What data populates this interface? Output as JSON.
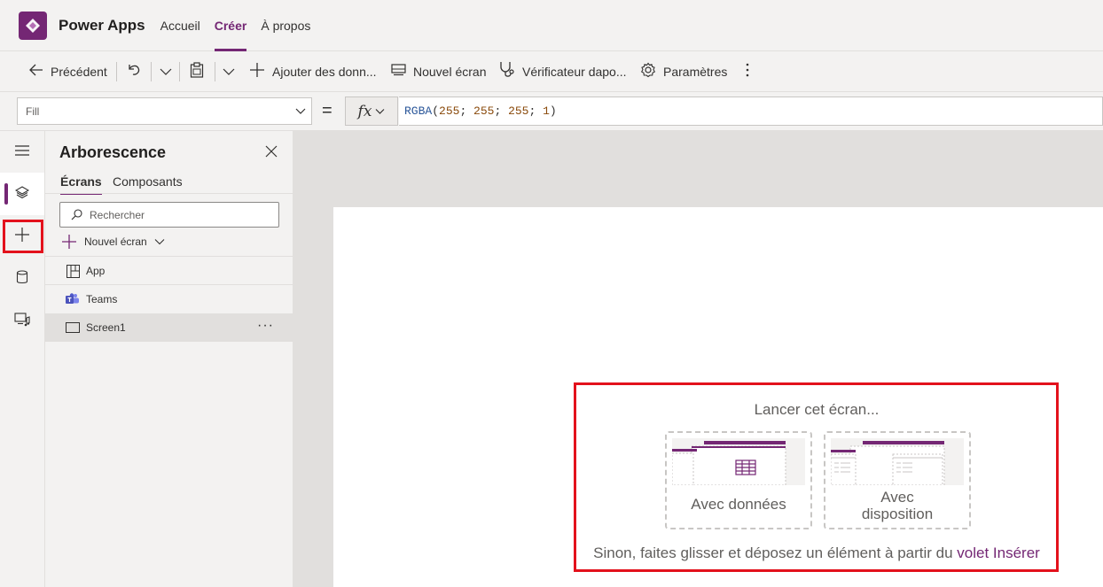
{
  "header": {
    "app_name": "Power Apps",
    "nav": [
      "Accueil",
      "Créer",
      "À propos"
    ],
    "active_nav": "Créer",
    "accent_color": "#742774"
  },
  "commandbar": {
    "back_label": "Précédent",
    "add_data_label": "Ajouter des donn...",
    "new_screen_label": "Nouvel écran",
    "checker_label": "Vérificateur dapo...",
    "settings_label": "Paramètres"
  },
  "formulabar": {
    "property": "Fill",
    "equals": "=",
    "fx": "fx",
    "formula": {
      "fn": "RGBA",
      "open": "(",
      "r": "255",
      "sep1": "; ",
      "g": "255",
      "sep2": "; ",
      "b": "255",
      "sep3": "; ",
      "a": "1",
      "close": ")"
    }
  },
  "rail": {
    "items": [
      "hamburger-icon",
      "layers-icon",
      "plus-icon",
      "database-icon",
      "media-icon"
    ],
    "selected": "layers-icon"
  },
  "tree": {
    "title": "Arborescence",
    "tabs": [
      "Écrans",
      "Composants"
    ],
    "active_tab": "Écrans",
    "search_placeholder": "Rechercher",
    "new_screen_label": "Nouvel écran",
    "items": [
      {
        "label": "App",
        "icon": "app-icon"
      },
      {
        "label": "Teams",
        "icon": "teams-icon"
      },
      {
        "label": "Screen1",
        "icon": "screen-icon",
        "more": "···"
      }
    ],
    "selected_item": "Screen1"
  },
  "canvas": {
    "start_title": "Lancer cet écran...",
    "cards": [
      {
        "label": "Avec données"
      },
      {
        "label_line1": "Avec",
        "label_line2": "disposition"
      }
    ],
    "bottom_text": "Sinon, faites glisser et déposez un élément à partir du ",
    "bottom_link": "volet Insérer"
  },
  "colors": {
    "highlight": "#e3111c",
    "accent": "#742774"
  }
}
